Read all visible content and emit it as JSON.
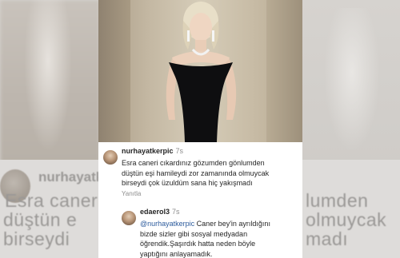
{
  "post": {
    "image_alt": "woman in black off-shoulder dress"
  },
  "comments": [
    {
      "username": "nurhayatkerpic",
      "time": "7s",
      "lines": [
        "Esra caneri cıkardınız gözumden gönlumden",
        "düştün eşi hamileydi zor zamanında olmuycak",
        "birseydi çok üzuldüm  sana hiç yakışmadı"
      ],
      "reply_label": "Yanıtla"
    },
    {
      "username": "edaerol3",
      "time": "7s",
      "mention": "@nurhayatkerpic",
      "lines_after_mention": " Caner bey'in ayrıldığını",
      "lines": [
        "bizde sizler gibi sosyal medyadan",
        "öğrendik.Şaşırdık hatta neden böyle",
        "yaptığını anlayamadık."
      ]
    }
  ],
  "background": {
    "username": "nurhayatkerpic",
    "lines": [
      "Esra caneri",
      "düştün e",
      "birseydi",
      "lumden",
      "olmuycak",
      "madı"
    ]
  }
}
